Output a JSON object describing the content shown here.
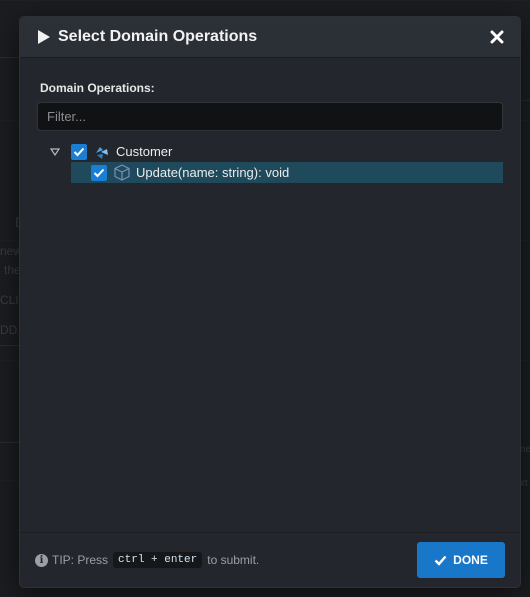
{
  "background": {
    "fragments": [
      "D",
      "new",
      "the",
      "CLI",
      "DD",
      "ne",
      "xt"
    ]
  },
  "dialog": {
    "title": "Select Domain Operations",
    "close_icon": "close-icon",
    "field_label": "Domain Operations:",
    "filter_placeholder": "Filter...",
    "tree": {
      "root": {
        "label": "Customer",
        "checked": true,
        "expanded": true,
        "icon": "class-icon"
      },
      "children": [
        {
          "label": "Update(name: string): void",
          "checked": true,
          "selected": true,
          "icon": "operation-cube-icon"
        }
      ]
    },
    "footer": {
      "tip_prefix": "TIP: Press",
      "shortcut": "ctrl + enter",
      "tip_suffix": "to submit.",
      "done_label": "DONE"
    }
  },
  "colors": {
    "accent": "#1877c9",
    "selected_row": "#1e4a5c",
    "checkbox": "#1a7fd4",
    "modal_bg": "#23262c",
    "header_bg": "#2b2f36"
  }
}
